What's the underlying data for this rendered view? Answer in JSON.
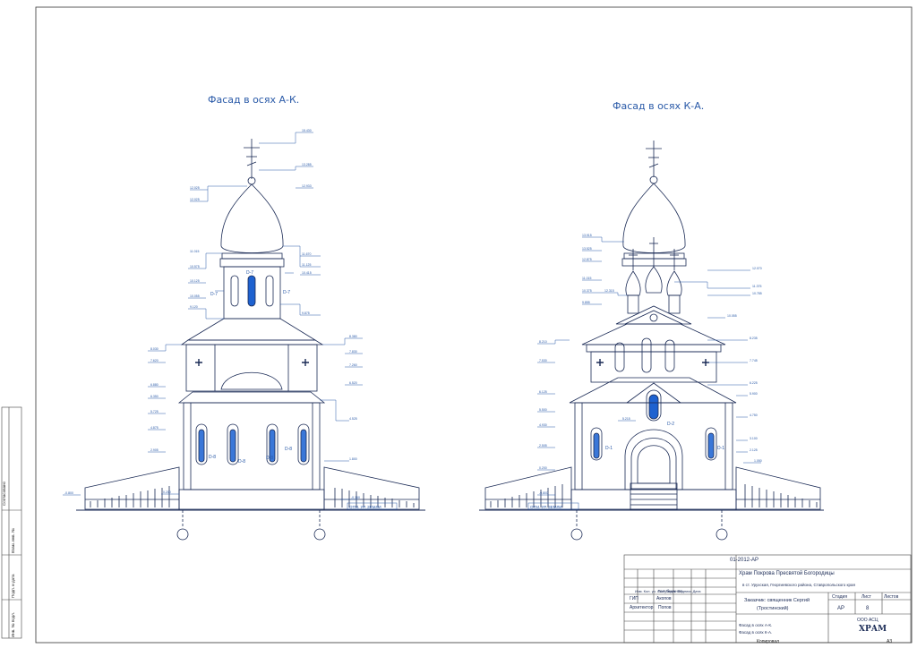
{
  "titles": {
    "left": "Фасад в осях А-К.",
    "right": "Фасад в осях К-А."
  },
  "labels": {
    "ground_left": "ОТМ. УР. ЗЕМЛИ",
    "ground_right": "ОТМ. УР. ЗЕМЛИ",
    "window_d7": "D-7",
    "window_d8": "D-8",
    "window_d1": "D-1",
    "window_d2": "D-2"
  },
  "stamp": {
    "code": "01-2012-АР",
    "name": "Храм Покрова Пресвятой Богородицы",
    "place": "в ст. Урухская, Георгиевского района, Ставропольского края",
    "customer": "Заказчик: священник Сергий",
    "customer2": "(Тростинский)",
    "col_stage": "Стадия",
    "col_sheet": "Лист",
    "col_sheets": "Листов",
    "stage": "АР",
    "sheet": "8",
    "facade1": "Фасад в осях А-К.",
    "facade2": "Фасад в осях К-А.",
    "org": "ООО АСЦ",
    "logo": "ХРАМ",
    "header_row": "Изм. Кол. уч. Лист №док. Подпись Дата",
    "role1": "ГИП",
    "person1": "Акопов",
    "role2": "Архитектор",
    "person2": "Попов",
    "person0": "Голубничная"
  },
  "footer": {
    "copied": "Копировал",
    "format": "А3"
  },
  "side": {
    "agreed": "Согласовано",
    "inv": "Взам. инв. №",
    "sign": "Подп. и дата",
    "inv2": "Инв. № подл."
  },
  "colors": {
    "line": "#1a2a55",
    "accent": "#2a5aa8",
    "window_fill": "#1e62d0"
  }
}
